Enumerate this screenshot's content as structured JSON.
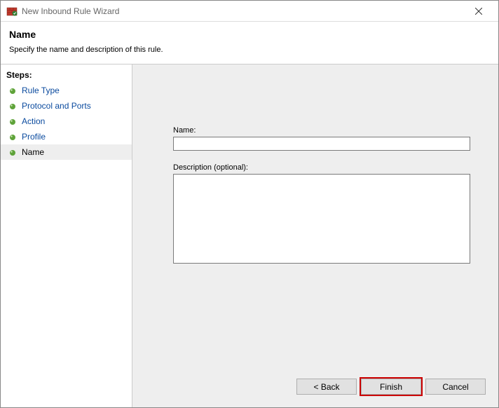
{
  "window": {
    "title": "New Inbound Rule Wizard"
  },
  "header": {
    "title": "Name",
    "subtitle": "Specify the name and description of this rule."
  },
  "sidebar": {
    "steps_label": "Steps:",
    "items": [
      {
        "label": "Rule Type",
        "current": false
      },
      {
        "label": "Protocol and Ports",
        "current": false
      },
      {
        "label": "Action",
        "current": false
      },
      {
        "label": "Profile",
        "current": false
      },
      {
        "label": "Name",
        "current": true
      }
    ]
  },
  "form": {
    "name_label": "Name:",
    "name_value": "",
    "desc_label": "Description (optional):",
    "desc_value": ""
  },
  "buttons": {
    "back": "< Back",
    "finish": "Finish",
    "cancel": "Cancel"
  }
}
